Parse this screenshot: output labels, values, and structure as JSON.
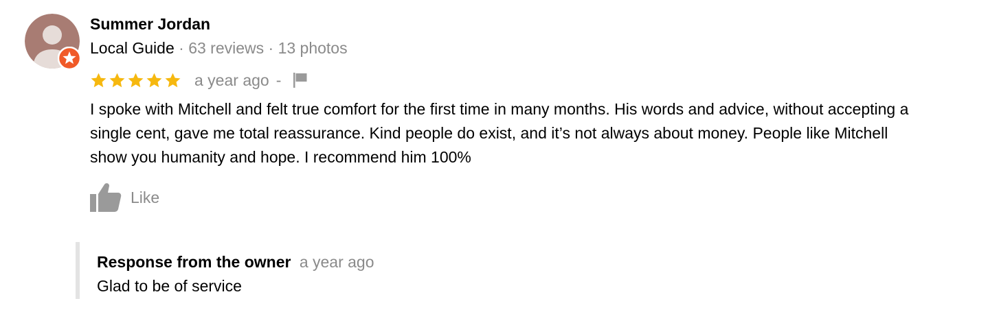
{
  "reviewer": {
    "name": "Summer Jordan",
    "badge_label": "Local Guide",
    "reviews_count": "· 63 reviews",
    "photos_count": "· 13 photos",
    "avatar_icon": "person-silhouette-icon",
    "badge_icon": "local-guide-star-icon"
  },
  "review": {
    "rating": 5,
    "rating_max": 5,
    "time": "a year ago",
    "separator": "-",
    "flag_icon": "flag-icon",
    "text": "I spoke with Mitchell and felt true comfort for the first time in many months.  His words and advice, without accepting a single cent, gave me total reassurance.  Kind people do exist, and it’s not always about money.  People like Mitchell show you humanity and hope.  I recommend him 100%",
    "like_label": "Like",
    "like_icon": "thumbs-up-icon"
  },
  "owner_response": {
    "title": "Response from the owner",
    "time": "a year ago",
    "text": "Glad to be of service"
  },
  "colors": {
    "star": "#F6B80F",
    "muted_text": "#8A8A8A",
    "icon_gray": "#9A9A9A",
    "badge": "#F05A28",
    "avatar_bg": "#A87C73",
    "avatar_figure": "#E6DCD8",
    "response_border": "#E3E3E3"
  }
}
